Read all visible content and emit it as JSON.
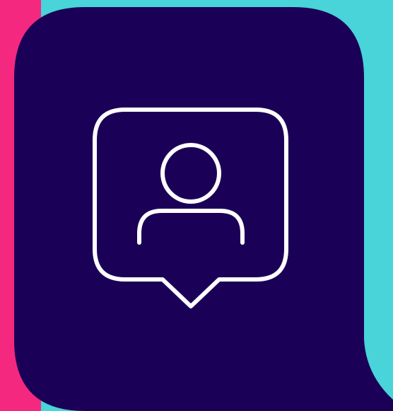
{
  "colors": {
    "background": "#48d4d8",
    "accent_stripe": "#f5287f",
    "bubble": "#1b0057",
    "icon_stroke": "#ffffff"
  },
  "icons": {
    "main": "user-chat-bubble-icon",
    "speech_bubble": "speech-bubble-icon",
    "person": "person-icon"
  }
}
